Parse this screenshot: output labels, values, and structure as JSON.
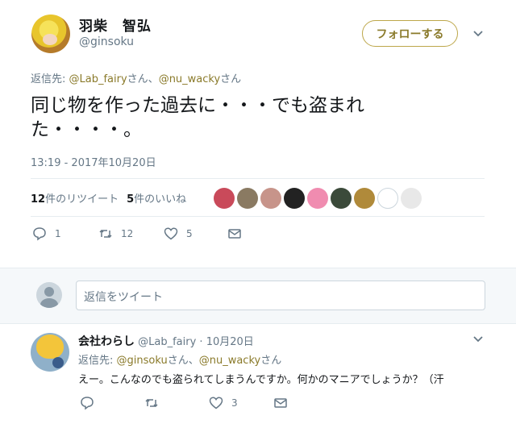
{
  "tweet": {
    "display_name": "羽柴　智弘",
    "handle": "@ginsoku",
    "follow_label": "フォローする",
    "reply_to_prefix": "返信先: ",
    "reply_to_user1": "@Lab_fairy",
    "reply_to_mid": "さん、",
    "reply_to_user2": "@nu_wacky",
    "reply_to_suffix": "さん",
    "text_line1": "同じ物を作った過去に・・・でも盗まれ",
    "text_line2": "た・・・・。",
    "timestamp": "13:19 - 2017年10月20日",
    "retweet_count": "12",
    "retweet_label": "件のリツイート",
    "like_count": "5",
    "like_label": "件のいいね",
    "likers": [
      {
        "color": "#c94a5a"
      },
      {
        "color": "#8a7a62"
      },
      {
        "color": "#c7948a"
      },
      {
        "color": "#222222"
      },
      {
        "color": "#f08cb0"
      },
      {
        "color": "#3b4a3a"
      },
      {
        "color": "#b08a3a"
      },
      {
        "color": "#ffffff"
      },
      {
        "color": "#e8e8e8"
      }
    ],
    "actions": {
      "reply": "1",
      "retweet": "12",
      "like": "5"
    }
  },
  "reply_box": {
    "placeholder": "返信をツイート"
  },
  "reply": {
    "display_name": "会社わらし",
    "handle": "@Lab_fairy",
    "dot": " · ",
    "date": "10月20日",
    "reply_to_prefix": "返信先: ",
    "reply_to_user1": "@ginsoku",
    "reply_to_mid": "さん、",
    "reply_to_user2": "@nu_wacky",
    "reply_to_suffix": "さん",
    "text": "えー。こんなのでも盗られてしまうんですか。何かのマニアでしょうか？（汗",
    "actions": {
      "like": "3"
    }
  },
  "colors": {
    "accent": "#8a7a2a",
    "muted": "#657786",
    "border": "#e6ecf0"
  }
}
